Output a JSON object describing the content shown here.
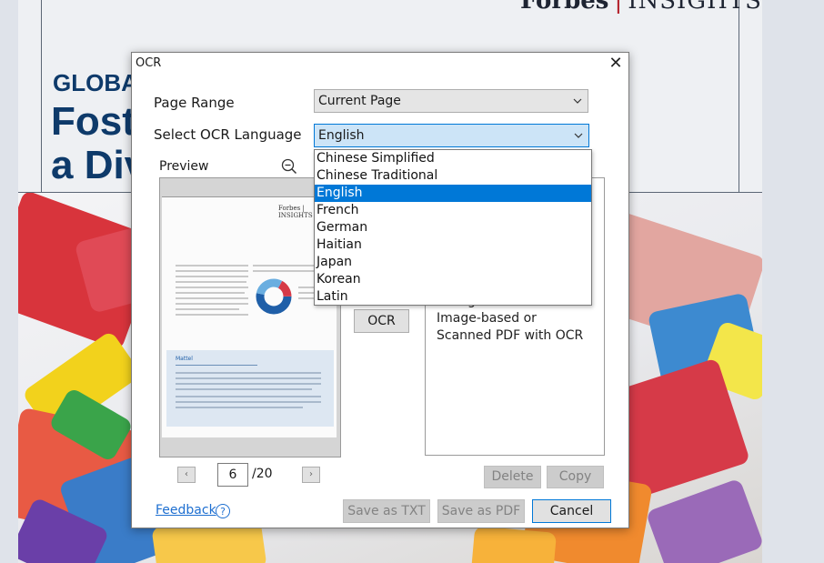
{
  "background_document": {
    "logo": {
      "brand": "Forbes",
      "suffix": "INSIGHTS"
    },
    "heading_small": "GLOBAL",
    "heading_line1": "Foste",
    "heading_line2": "a Div"
  },
  "dialog": {
    "title": "OCR",
    "close_glyph": "✕",
    "page_range": {
      "label": "Page Range",
      "value": "Current Page"
    },
    "ocr_language": {
      "label": "Select OCR Language",
      "value": "English",
      "options": [
        "Chinese Simplified",
        "Chinese Traditional",
        "English",
        "French",
        "German",
        "Haitian",
        "Japan",
        "Korean",
        "Latin"
      ],
      "selected_index": 2
    },
    "preview": {
      "label": "Preview",
      "zoom_icon": "zoom-out-icon",
      "thumbnail_brand": "Forbes | INSIGHTS",
      "thumbnail_section": "Mattel"
    },
    "ocr_button": "OCR",
    "result_placeholder": "Recognize text from\nImage-based or\nScanned PDF with OCR",
    "pagination": {
      "prev": "‹",
      "next": "›",
      "current": "6",
      "total": "/20"
    },
    "delete_button": "Delete",
    "copy_button": "Copy",
    "feedback_link": "Feedback",
    "help_icon": "?",
    "save_txt_button": "Save as TXT",
    "save_pdf_button": "Save as PDF",
    "cancel_button": "Cancel"
  },
  "colors": {
    "accent": "#0078d7",
    "brand_navy": "#0e3a6a",
    "link": "#1e6fd0"
  }
}
